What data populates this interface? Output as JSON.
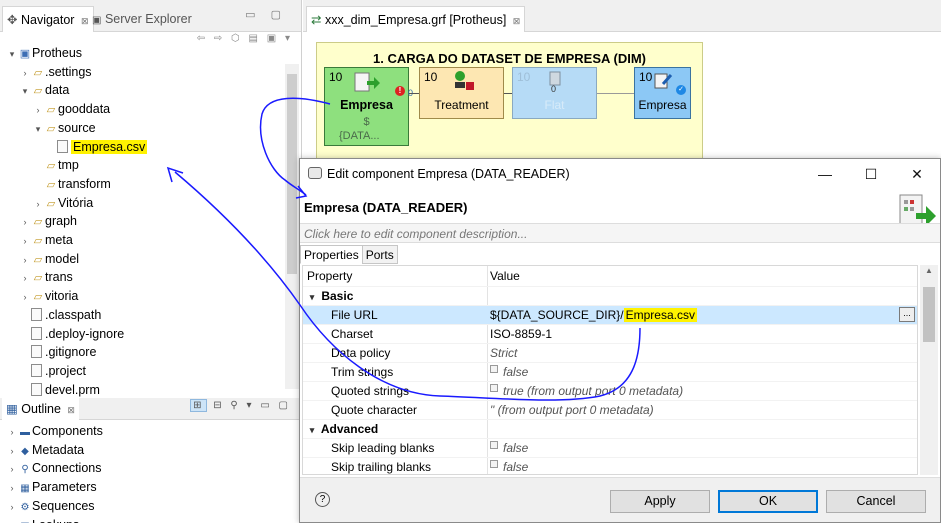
{
  "navigator": {
    "tab_label": "Navigator",
    "tab_close": "⊠",
    "tab2_label": "Server Explorer",
    "items": [
      {
        "label": "Protheus",
        "indent": 0,
        "twisty": "▾"
      },
      {
        "label": ".settings",
        "indent": 1,
        "twisty": "›"
      },
      {
        "label": "data",
        "indent": 1,
        "twisty": "▾"
      },
      {
        "label": "gooddata",
        "indent": 2,
        "twisty": "›"
      },
      {
        "label": "source",
        "indent": 2,
        "twisty": "▾"
      },
      {
        "label": "Empresa.csv",
        "indent": 3,
        "twisty": "",
        "file": true,
        "highlight": true
      },
      {
        "label": "tmp",
        "indent": 2,
        "twisty": ""
      },
      {
        "label": "transform",
        "indent": 2,
        "twisty": ""
      },
      {
        "label": "Vitória",
        "indent": 2,
        "twisty": "›"
      },
      {
        "label": "graph",
        "indent": 1,
        "twisty": "›"
      },
      {
        "label": "meta",
        "indent": 1,
        "twisty": "›"
      },
      {
        "label": "model",
        "indent": 1,
        "twisty": "›"
      },
      {
        "label": "trans",
        "indent": 1,
        "twisty": "›"
      },
      {
        "label": "vitoria",
        "indent": 1,
        "twisty": "›"
      },
      {
        "label": ".classpath",
        "indent": 1,
        "twisty": "",
        "file": true
      },
      {
        "label": ".deploy-ignore",
        "indent": 1,
        "twisty": "",
        "file": true
      },
      {
        "label": ".gitignore",
        "indent": 1,
        "twisty": "",
        "file": true
      },
      {
        "label": ".project",
        "indent": 1,
        "twisty": "",
        "file": true
      },
      {
        "label": "devel.prm",
        "indent": 1,
        "twisty": "",
        "file": true
      }
    ]
  },
  "outline": {
    "tab_label": "Outline",
    "tab_close": "⊠",
    "items": [
      {
        "label": "Components",
        "icon": "▬"
      },
      {
        "label": "Metadata",
        "icon": "◆"
      },
      {
        "label": "Connections",
        "icon": "⚲"
      },
      {
        "label": "Parameters",
        "icon": "▦"
      },
      {
        "label": "Sequences",
        "icon": "⚙"
      },
      {
        "label": "Lookups",
        "icon": "▤"
      }
    ]
  },
  "editor": {
    "tab_label": "xxx_dim_Empresa.grf [Protheus]",
    "tab_close": "⊠",
    "phase_title": "1. CARGA DO DATASET DE EMPRESA (DIM)",
    "components": [
      {
        "num": "10",
        "label": "Empresa",
        "sub1": "$",
        "sub2": "{DATA..."
      },
      {
        "num": "10",
        "label": "Treatment"
      },
      {
        "num": "10",
        "label": "Flat"
      },
      {
        "num": "10",
        "label": "Empresa"
      }
    ],
    "port_counts": [
      "0",
      "0",
      "0"
    ]
  },
  "dialog": {
    "title": "Edit component Empresa (DATA_READER)",
    "minimize": "—",
    "maximize": "☐",
    "close": "✕",
    "heading": "Empresa (DATA_READER)",
    "description": "Click here to edit component description...",
    "tabs": [
      "Properties",
      "Ports"
    ],
    "col_property": "Property",
    "col_value": "Value",
    "groups": [
      {
        "name": "Basic",
        "rows": [
          {
            "name": "File URL",
            "value_prefix": "${DATA_SOURCE_DIR}/",
            "value_hl": "Empresa.csv",
            "selected": true,
            "browse": "..."
          },
          {
            "name": "Charset",
            "value": "ISO-8859-1"
          },
          {
            "name": "Data policy",
            "value": "Strict",
            "italic": true
          },
          {
            "name": "Trim strings",
            "value": "false",
            "italic": true,
            "checkbox": true
          },
          {
            "name": "Quoted strings",
            "value": "true (from output port 0 metadata)",
            "italic": true,
            "checkbox": true
          },
          {
            "name": "Quote character",
            "value": "\" (from output port 0 metadata)",
            "italic": true
          }
        ]
      },
      {
        "name": "Advanced",
        "rows": [
          {
            "name": "Skip leading blanks",
            "value": "false",
            "italic": true,
            "checkbox": true
          },
          {
            "name": "Skip trailing blanks",
            "value": "false",
            "italic": true,
            "checkbox": true
          }
        ]
      }
    ],
    "help": "?",
    "buttons": {
      "apply": "Apply",
      "ok": "OK",
      "cancel": "Cancel"
    }
  },
  "colors": {
    "accent_highlight": "#fff200",
    "phase_bg": "#ffffcc",
    "reader_green": "#8ee07e",
    "treatment": "#fde7b2",
    "writer_blue": "#8cc8f5",
    "selection": "#cce8ff",
    "annotation": "#1a1aff"
  }
}
